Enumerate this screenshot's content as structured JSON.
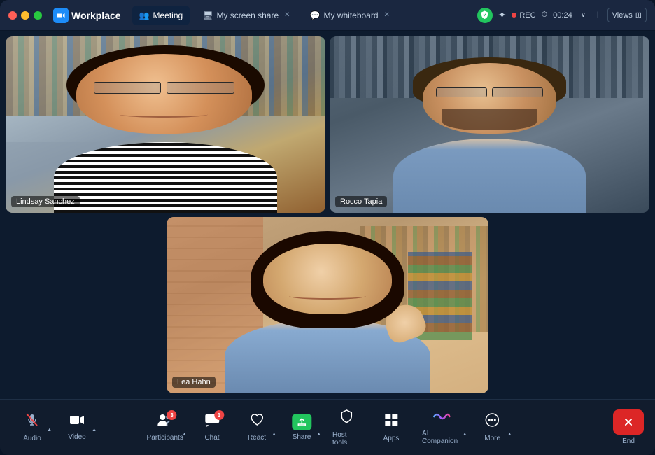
{
  "app": {
    "title": "Zoom Workplace",
    "logo_text": "zoom",
    "workplace_text": "Workplace"
  },
  "title_bar": {
    "tabs": [
      {
        "id": "meeting",
        "label": "Meeting",
        "icon": "👥",
        "closable": false,
        "active": true
      },
      {
        "id": "screen-share",
        "label": "My screen share",
        "icon": "🖥",
        "closable": true,
        "active": false
      },
      {
        "id": "whiteboard",
        "label": "My whiteboard",
        "icon": "💬",
        "closable": true,
        "active": false
      }
    ],
    "rec_label": "REC",
    "timer": "00:24",
    "views_label": "Views"
  },
  "participants": [
    {
      "id": "lindsay",
      "name": "Lindsay Sanchez",
      "position": "top-left"
    },
    {
      "id": "rocco",
      "name": "Rocco Tapia",
      "position": "top-right"
    },
    {
      "id": "lea",
      "name": "Lea Hahn",
      "position": "bottom-center"
    }
  ],
  "toolbar": {
    "buttons": [
      {
        "id": "audio",
        "label": "Audio",
        "icon": "🎤",
        "has_caret": true,
        "badge": null,
        "muted": true
      },
      {
        "id": "video",
        "label": "Video",
        "icon": "📹",
        "has_caret": true,
        "badge": null,
        "muted": false
      },
      {
        "id": "participants",
        "label": "Participants",
        "icon": "👥",
        "has_caret": true,
        "badge": "3",
        "muted": false
      },
      {
        "id": "chat",
        "label": "Chat",
        "icon": "💬",
        "has_caret": false,
        "badge": "1",
        "muted": false
      },
      {
        "id": "react",
        "label": "React",
        "icon": "♡",
        "has_caret": true,
        "badge": null,
        "muted": false
      },
      {
        "id": "share",
        "label": "Share",
        "icon": "↑",
        "has_caret": true,
        "badge": null,
        "muted": false,
        "green": true
      },
      {
        "id": "host-tools",
        "label": "Host tools",
        "icon": "🛡",
        "has_caret": false,
        "badge": null,
        "muted": false
      },
      {
        "id": "apps",
        "label": "Apps",
        "icon": "⊞",
        "has_caret": false,
        "badge": null,
        "muted": false
      },
      {
        "id": "ai-companion",
        "label": "AI Companion",
        "icon": "~",
        "has_caret": true,
        "badge": null,
        "muted": false
      },
      {
        "id": "more",
        "label": "More",
        "icon": "···",
        "has_caret": true,
        "badge": null,
        "muted": false
      }
    ],
    "end_label": "End"
  }
}
